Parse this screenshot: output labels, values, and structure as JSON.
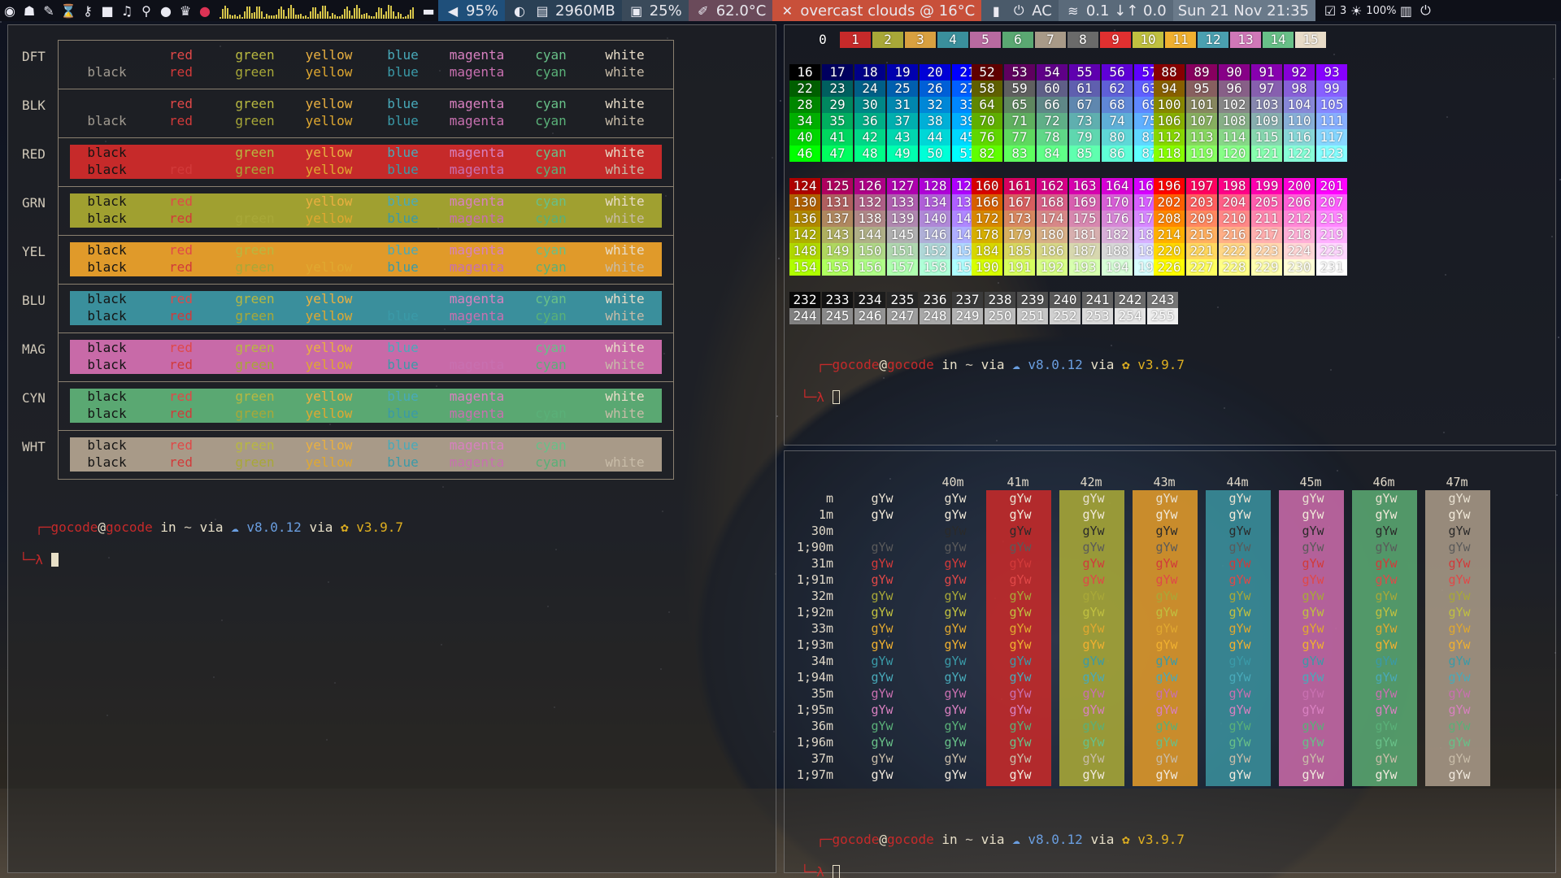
{
  "bar": {
    "cpu_pct": "95%",
    "mem": "2960MB",
    "disk": "25%",
    "temp": "62.0°C",
    "weather": "overcast clouds @ 16°C",
    "power": "AC",
    "net": "0.1 ↓↑ 0.0",
    "datetime": "Sun 21 Nov 21:35",
    "ws_count": "3",
    "brightness": "100%",
    "colors": {
      "vol": "#1f4f7a",
      "mem": "#2a4055",
      "disk": "#3a4a5a",
      "temp": "#6a4a5a",
      "weather": "#c8503a",
      "power": "#4a5a6a",
      "net": "#5a6a7a",
      "date": "#6a7a8a"
    }
  },
  "left": {
    "rows": [
      {
        "label": "DFT",
        "bg": "none",
        "top": [
          "",
          "red",
          "green",
          "yellow",
          "blue",
          "magenta",
          "cyan",
          "white"
        ],
        "bot": [
          "black",
          "red",
          "green",
          "yellow",
          "blue",
          "magenta",
          "cyan",
          "white"
        ]
      },
      {
        "label": "BLK",
        "bg": "none",
        "top": [
          "",
          "red",
          "green",
          "yellow",
          "blue",
          "magenta",
          "cyan",
          "white"
        ],
        "bot": [
          "black",
          "red",
          "green",
          "yellow",
          "blue",
          "magenta",
          "cyan",
          "white"
        ]
      },
      {
        "label": "RED",
        "bg": "#c62a2a",
        "top": [
          "black",
          "",
          "green",
          "yellow",
          "blue",
          "magenta",
          "cyan",
          "white"
        ],
        "bot": [
          "black",
          "red",
          "green",
          "yellow",
          "blue",
          "magenta",
          "cyan",
          "white"
        ]
      },
      {
        "label": "GRN",
        "bg": "#a0a030",
        "top": [
          "black",
          "red",
          "",
          "yellow",
          "blue",
          "magenta",
          "cyan",
          "white"
        ],
        "bot": [
          "black",
          "red",
          "green",
          "yellow",
          "blue",
          "magenta",
          "cyan",
          "white"
        ]
      },
      {
        "label": "YEL",
        "bg": "#e09a2a",
        "top": [
          "black",
          "red",
          "green",
          "",
          "blue",
          "magenta",
          "cyan",
          "white"
        ],
        "bot": [
          "black",
          "red",
          "green",
          "yellow",
          "blue",
          "magenta",
          "cyan",
          "white"
        ]
      },
      {
        "label": "BLU",
        "bg": "#3a8f9c",
        "top": [
          "black",
          "red",
          "green",
          "yellow",
          "",
          "magenta",
          "cyan",
          "white"
        ],
        "bot": [
          "black",
          "red",
          "green",
          "yellow",
          "blue",
          "magenta",
          "cyan",
          "white"
        ]
      },
      {
        "label": "MAG",
        "bg": "#c86aa8",
        "top": [
          "black",
          "red",
          "green",
          "yellow",
          "blue",
          "",
          "cyan",
          "white"
        ],
        "bot": [
          "black",
          "red",
          "green",
          "yellow",
          "blue",
          "magenta",
          "cyan",
          "white"
        ]
      },
      {
        "label": "CYN",
        "bg": "#5aa872",
        "top": [
          "black",
          "red",
          "green",
          "yellow",
          "blue",
          "magenta",
          "",
          "white"
        ],
        "bot": [
          "black",
          "red",
          "green",
          "yellow",
          "blue",
          "magenta",
          "cyan",
          "white"
        ]
      },
      {
        "label": "WHT",
        "bg": "#a89a88",
        "top": [
          "black",
          "red",
          "green",
          "yellow",
          "blue",
          "magenta",
          "cyan",
          ""
        ],
        "bot": [
          "black",
          "red",
          "green",
          "yellow",
          "blue",
          "magenta",
          "cyan",
          "white"
        ]
      }
    ]
  },
  "prompt": {
    "user": "gocode",
    "at": "@",
    "host": "gocode",
    "rest1": " in ",
    "tilde": "~",
    "via1": " via ",
    "node": "v8.0.12",
    "via2": " via ",
    "py": "v3.9.7",
    "lambda": "λ"
  },
  "palette": {
    "basic": [
      "0",
      "1",
      "2",
      "3",
      "4",
      "5",
      "6",
      "7",
      "8",
      "9",
      "10",
      "11",
      "12",
      "13",
      "14",
      "15"
    ]
  },
  "gyw": {
    "headers": [
      "40m",
      "41m",
      "42m",
      "43m",
      "44m",
      "45m",
      "46m",
      "47m"
    ],
    "rows": [
      "m",
      "1m",
      "30m",
      "1;90m",
      "31m",
      "1;91m",
      "32m",
      "1;92m",
      "33m",
      "1;93m",
      "34m",
      "1;94m",
      "35m",
      "1;95m",
      "36m",
      "1;96m",
      "37m",
      "1;97m"
    ],
    "sample": "gYw"
  }
}
